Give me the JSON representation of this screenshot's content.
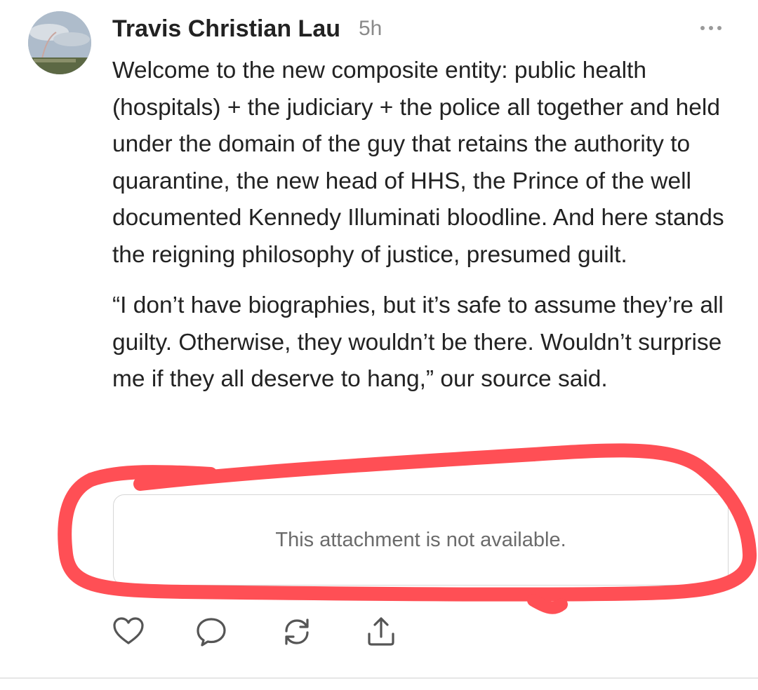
{
  "post": {
    "author": "Travis Christian Lau",
    "time": "5h",
    "paragraphs": [
      "Welcome to the new composite entity: public health (hospitals) + the judiciary + the police all together and held under the domain of the guy that retains the authority to quarantine, the new head of HHS, the Prince of the well documented Kennedy Illuminati bloodline. And here stands the reigning philosophy of justice, presumed guilt.",
      "“I don’t have biographies, but it’s safe to assume they’re all guilty. Otherwise, they wouldn’t be there. Wouldn’t surprise me if they all deserve to hang,” our source said."
    ],
    "attachment_text": "This attachment is not available."
  },
  "icons": {
    "more": "more-dots-icon",
    "like": "heart-icon",
    "reply": "comment-icon",
    "repost": "repost-icon",
    "share": "share-icon"
  },
  "colors": {
    "highlight": "#ff4f55",
    "text": "#222222",
    "muted": "#8a8a8a"
  }
}
